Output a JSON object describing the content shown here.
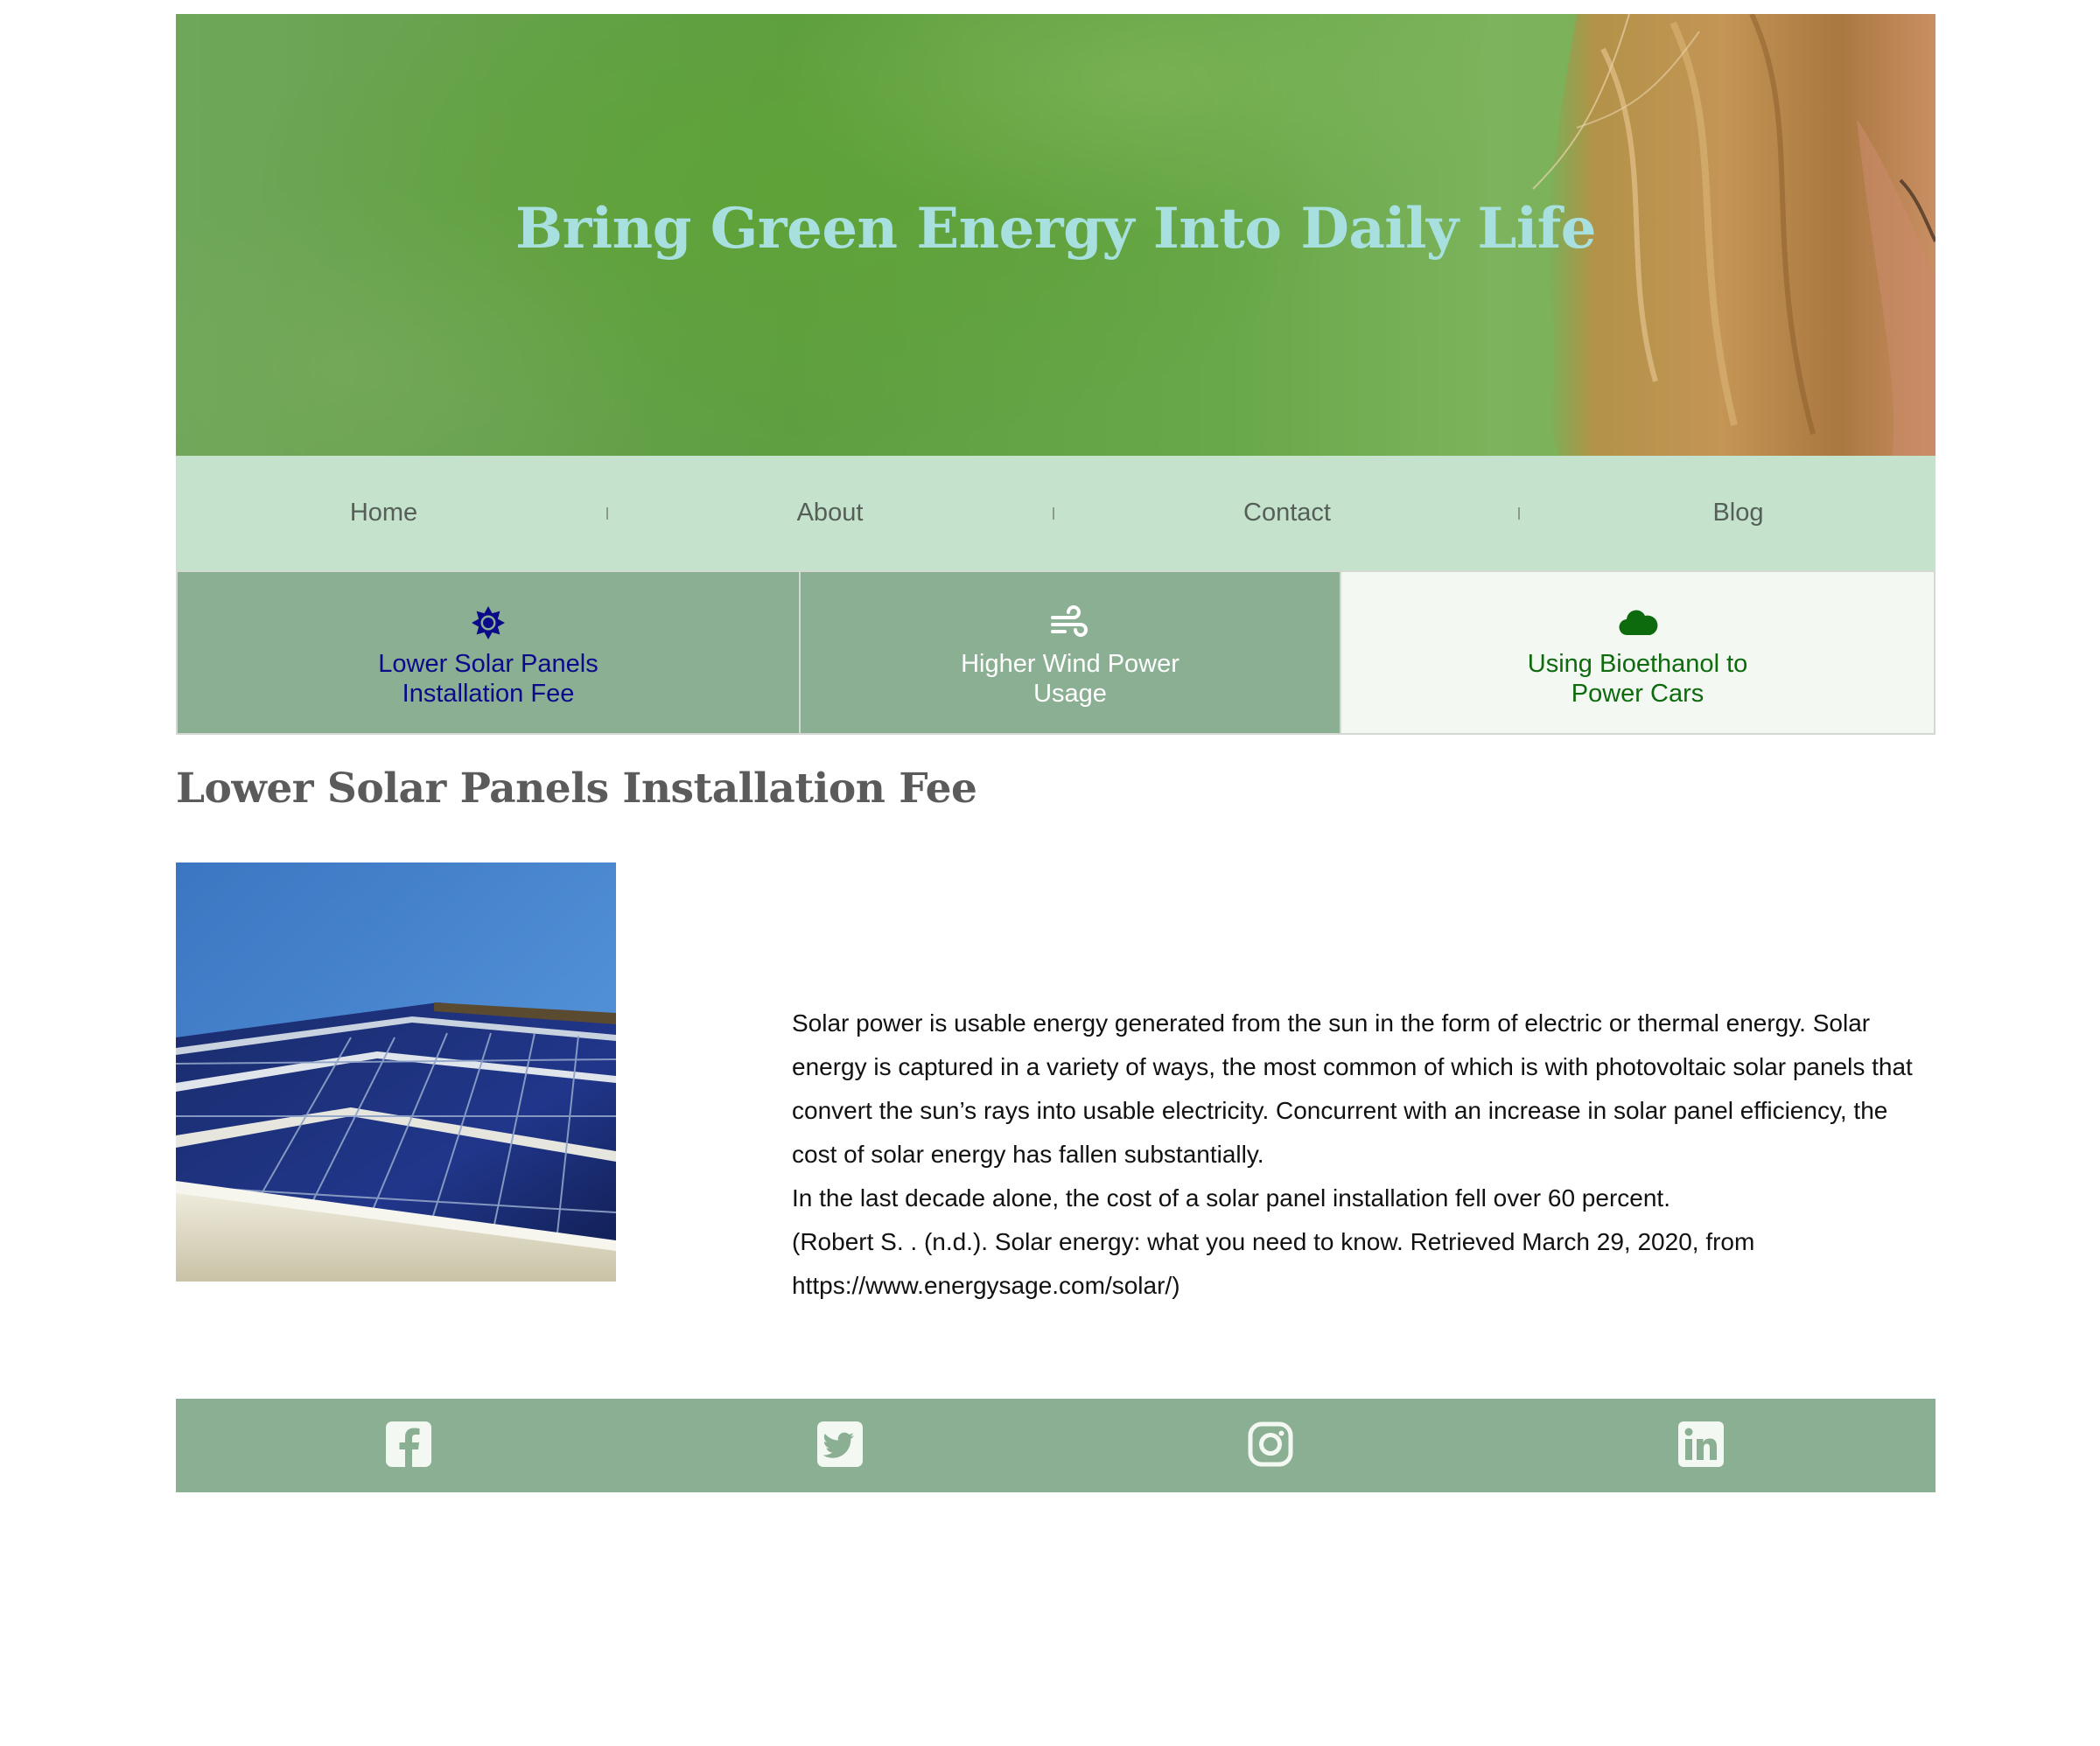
{
  "hero": {
    "title": "Bring Green Energy Into Daily Life"
  },
  "nav": {
    "items": [
      {
        "label": "Home"
      },
      {
        "label": "About"
      },
      {
        "label": "Contact"
      },
      {
        "label": "Blog"
      }
    ]
  },
  "tabs": [
    {
      "label": "Lower Solar Panels Installation Fee",
      "icon": "sun-icon",
      "active": false,
      "text_color": "#0a0a8a"
    },
    {
      "label": "Higher Wind Power Usage",
      "icon": "wind-icon",
      "active": false,
      "text_color": "#ffffff"
    },
    {
      "label": "Using Bioethanol to Power Cars",
      "icon": "cloud-icon",
      "active": true,
      "text_color": "#0d6b0d"
    }
  ],
  "content": {
    "title": "Lower Solar Panels Installation Fee",
    "paragraphs": [
      "Solar power is usable energy generated from the sun in the form of electric or thermal energy. Solar energy is captured in a variety of ways, the most common of which is with photovoltaic solar panels that convert the sun’s rays into usable electricity. Concurrent with an increase in solar panel efficiency, the cost of solar energy has fallen substantially.",
      "In the last decade alone, the cost of a solar panel installation fell over 60 percent.",
      "(Robert S. . (n.d.). Solar energy: what you need to know. Retrieved March 29, 2020, from https://www.energysage.com/solar/)"
    ]
  },
  "footer": {
    "social": [
      "facebook-icon",
      "twitter-icon",
      "instagram-icon",
      "linkedin-icon"
    ]
  },
  "colors": {
    "hero_title": "#a8e0e0",
    "nav_bg": "#c5e3cc",
    "tab_bg": "#8baf92",
    "tab_active_bg": "#f3f8f2",
    "footer_bg": "#8baf92"
  }
}
